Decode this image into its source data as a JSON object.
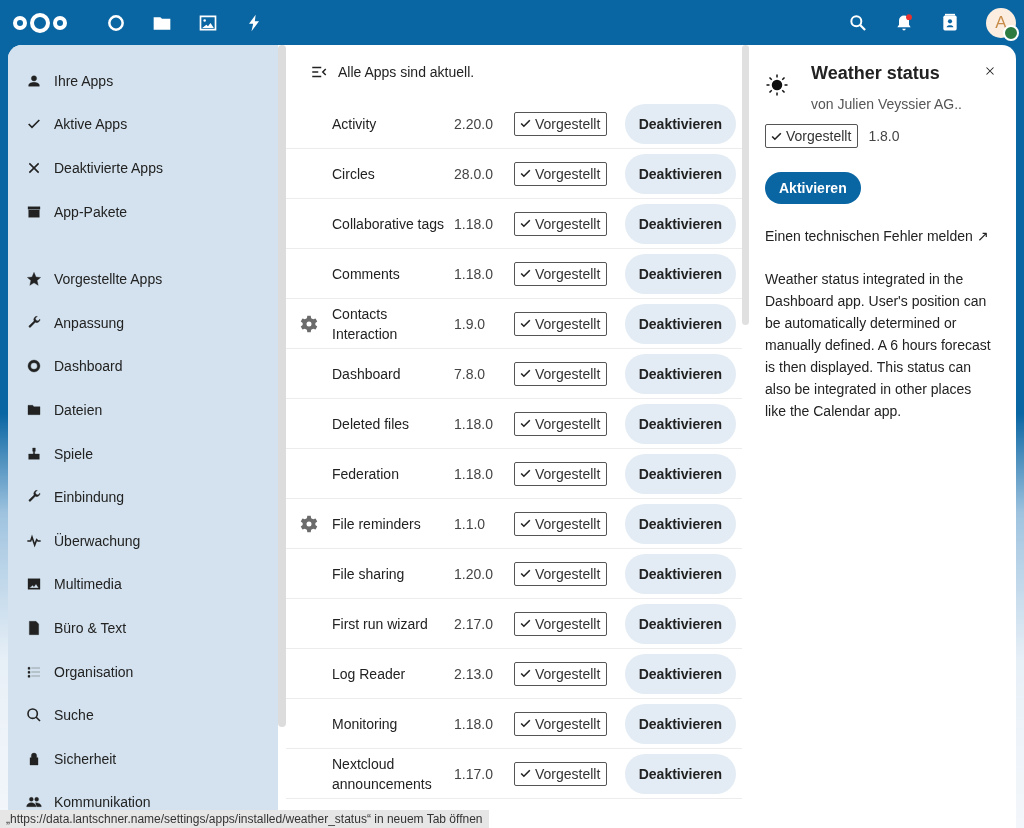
{
  "sidebar": {
    "groups": [
      [
        {
          "label": "Ihre Apps"
        },
        {
          "label": "Aktive Apps"
        },
        {
          "label": "Deaktivierte Apps"
        },
        {
          "label": "App-Pakete"
        }
      ],
      [
        {
          "label": "Vorgestellte Apps"
        },
        {
          "label": "Anpassung"
        },
        {
          "label": "Dashboard"
        },
        {
          "label": "Dateien"
        },
        {
          "label": "Spiele"
        },
        {
          "label": "Einbindung"
        },
        {
          "label": "Überwachung"
        },
        {
          "label": "Multimedia"
        },
        {
          "label": "Büro & Text"
        },
        {
          "label": "Organisation"
        },
        {
          "label": "Suche"
        },
        {
          "label": "Sicherheit"
        },
        {
          "label": "Kommunikation"
        }
      ]
    ]
  },
  "list": {
    "status": "Alle Apps sind aktuell.",
    "apps": [
      {
        "name": "Activity",
        "version": "2.20.0",
        "badge": "Vorgestellt",
        "action": "Deaktivieren",
        "settings": false
      },
      {
        "name": "Circles",
        "version": "28.0.0",
        "badge": "Vorgestellt",
        "action": "Deaktivieren",
        "settings": false
      },
      {
        "name": "Collaborative tags",
        "version": "1.18.0",
        "badge": "Vorgestellt",
        "action": "Deaktivieren",
        "settings": false
      },
      {
        "name": "Comments",
        "version": "1.18.0",
        "badge": "Vorgestellt",
        "action": "Deaktivieren",
        "settings": false
      },
      {
        "name": "Contacts Interaction",
        "version": "1.9.0",
        "badge": "Vorgestellt",
        "action": "Deaktivieren",
        "settings": true
      },
      {
        "name": "Dashboard",
        "version": "7.8.0",
        "badge": "Vorgestellt",
        "action": "Deaktivieren",
        "settings": false
      },
      {
        "name": "Deleted files",
        "version": "1.18.0",
        "badge": "Vorgestellt",
        "action": "Deaktivieren",
        "settings": false
      },
      {
        "name": "Federation",
        "version": "1.18.0",
        "badge": "Vorgestellt",
        "action": "Deaktivieren",
        "settings": false
      },
      {
        "name": "File reminders",
        "version": "1.1.0",
        "badge": "Vorgestellt",
        "action": "Deaktivieren",
        "settings": true
      },
      {
        "name": "File sharing",
        "version": "1.20.0",
        "badge": "Vorgestellt",
        "action": "Deaktivieren",
        "settings": false
      },
      {
        "name": "First run wizard",
        "version": "2.17.0",
        "badge": "Vorgestellt",
        "action": "Deaktivieren",
        "settings": false
      },
      {
        "name": "Log Reader",
        "version": "2.13.0",
        "badge": "Vorgestellt",
        "action": "Deaktivieren",
        "settings": false
      },
      {
        "name": "Monitoring",
        "version": "1.18.0",
        "badge": "Vorgestellt",
        "action": "Deaktivieren",
        "settings": false
      },
      {
        "name": "Nextcloud announcements",
        "version": "1.17.0",
        "badge": "Vorgestellt",
        "action": "Deaktivieren",
        "settings": false
      }
    ]
  },
  "details": {
    "title": "Weather status",
    "author": "von Julien Veyssier AG..",
    "badge": "Vorgestellt",
    "version": "1.8.0",
    "action": "Aktivieren",
    "bug_link": "Einen technischen Fehler melden ↗",
    "description": "Weather status integrated in the Dashboard app. User's position can be automatically determined or manually defined. A 6 hours forecast is then displayed. This status can also be integrated in other places like the Calendar app."
  },
  "user": {
    "initial": "A",
    "online": true
  },
  "notifications": {
    "unread": true
  },
  "link_tooltip": "„https://data.lantschner.name/settings/apps/installed/weather_status“ in neuem Tab öffnen"
}
